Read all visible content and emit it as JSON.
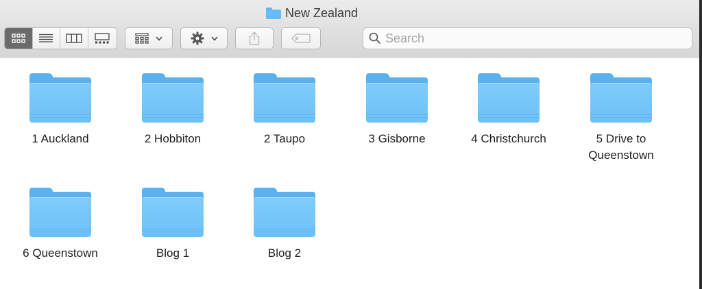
{
  "window": {
    "title": "New Zealand"
  },
  "toolbar": {
    "view_buttons": [
      {
        "name": "icon-view-icon",
        "active": true
      },
      {
        "name": "list-view-icon",
        "active": false
      },
      {
        "name": "column-view-icon",
        "active": false
      },
      {
        "name": "gallery-view-icon",
        "active": false
      }
    ],
    "arrange_icon": "grid-arrange-icon",
    "action_icon": "gear-icon",
    "share_icon": "share-icon",
    "tag_icon": "tag-icon"
  },
  "search": {
    "placeholder": "Search",
    "value": ""
  },
  "folders": [
    {
      "label": "1 Auckland"
    },
    {
      "label": "2 Hobbiton"
    },
    {
      "label": "2 Taupo"
    },
    {
      "label": "3 Gisborne"
    },
    {
      "label": "4 Christchurch"
    },
    {
      "label": "5 Drive to Queenstown"
    },
    {
      "label": "6 Queenstown"
    },
    {
      "label": "Blog 1"
    },
    {
      "label": "Blog 2"
    }
  ],
  "colors": {
    "folder": "#6cc0f8",
    "active_view": "#6b6b6b",
    "toolbar_bg": "#dcdcdc"
  }
}
